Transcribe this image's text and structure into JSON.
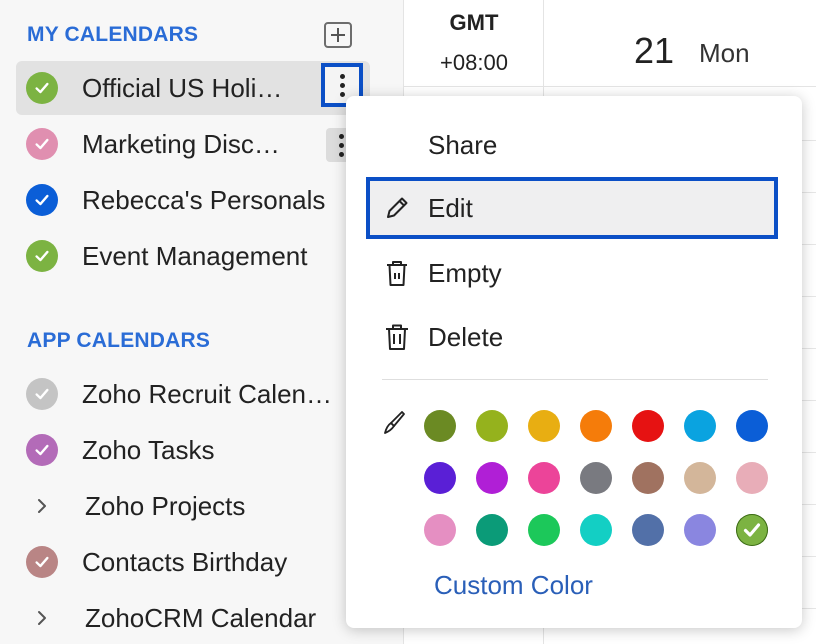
{
  "sidebar": {
    "my_calendars_title": "MY CALENDARS",
    "my_calendars": [
      {
        "name": "Official US Holi…",
        "color": "#7cb342",
        "checked": true,
        "active": true
      },
      {
        "name": "Marketing Disc…",
        "color": "#e08fb0",
        "checked": true
      },
      {
        "name": "Rebecca's Personals",
        "color": "#0b5ed7",
        "checked": true
      },
      {
        "name": "Event Management",
        "color": "#7cb342",
        "checked": true
      }
    ],
    "app_calendars_title": "APP CALENDARS",
    "app_calendars": [
      {
        "name": "Zoho Recruit Calen…",
        "color": "#c4c4c4",
        "type": "check"
      },
      {
        "name": "Zoho Tasks",
        "color": "#b36bb8",
        "type": "check"
      },
      {
        "name": "Zoho Projects",
        "type": "chevron"
      },
      {
        "name": "Contacts Birthday",
        "color": "#b98585",
        "type": "check"
      },
      {
        "name": "ZohoCRM Calendar",
        "type": "chevron"
      }
    ]
  },
  "main": {
    "tz_label": "GMT",
    "tz_offset": "+08:00",
    "date_number": "21",
    "date_day": "Mon"
  },
  "menu": {
    "items": [
      {
        "label": "Share",
        "icon": "none"
      },
      {
        "label": "Edit",
        "icon": "pencil-icon",
        "highlighted": true
      },
      {
        "label": "Empty",
        "icon": "empty-trash-icon"
      },
      {
        "label": "Delete",
        "icon": "trash-icon"
      }
    ],
    "palette_icon": "brush-icon",
    "colors": [
      "#6b8a23",
      "#95b21d",
      "#e8ae12",
      "#f57c0a",
      "#e61212",
      "#0aa3e0",
      "#0b5ed7",
      "#5a1fd6",
      "#b01fd6",
      "#ec4499",
      "#797a80",
      "#a07260",
      "#d3b69a",
      "#e8adb8",
      "#e58fc2",
      "#0b9b78",
      "#1cc85a",
      "#13cfc4",
      "#5270a8",
      "#8a86e0",
      "#7cb342"
    ],
    "selected_color_index": 20,
    "custom_color_label": "Custom Color"
  }
}
